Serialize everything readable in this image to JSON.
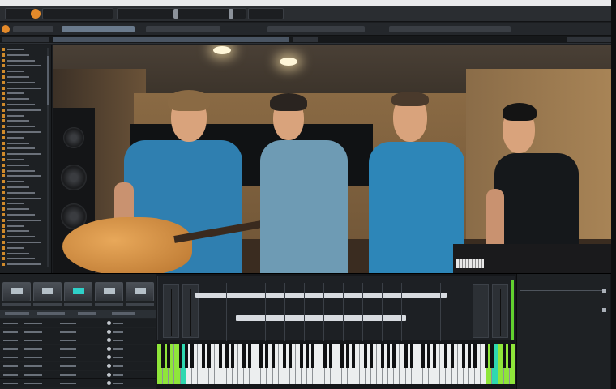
{
  "window": {
    "title": "",
    "center_title": ""
  },
  "transport": {
    "display_label": ""
  },
  "browser": {
    "item_count": 40
  },
  "scene": {
    "description_only_visual": true
  },
  "pads": {
    "count": 5,
    "highlighted_index": 3
  },
  "keyboard": {
    "white_key_count": 62,
    "green_keys_left": [
      0,
      1,
      2,
      3
    ],
    "teal_keys_left": [
      4
    ],
    "green_keys_right": [
      57,
      59,
      60,
      61
    ],
    "teal_keys_right": [
      58
    ]
  },
  "colors": {
    "accent_orange": "#e48a2a",
    "accent_green": "#8fe63a",
    "accent_teal": "#2fd8b0",
    "panel_dark": "#1d2023"
  },
  "icons": [
    "record-icon",
    "folder-icon"
  ]
}
